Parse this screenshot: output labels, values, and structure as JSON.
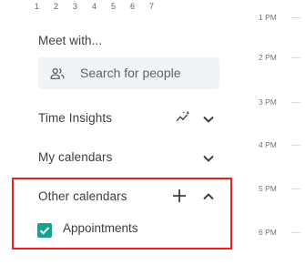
{
  "mini_calendar": {
    "day_numbers": [
      "1",
      "2",
      "3",
      "4",
      "5",
      "6",
      "7"
    ]
  },
  "meet": {
    "title": "Meet with...",
    "search_placeholder": "Search for people"
  },
  "time_insights": {
    "title": "Time Insights"
  },
  "my_calendars": {
    "title": "My calendars"
  },
  "other_calendars": {
    "title": "Other calendars",
    "items": [
      {
        "label": "Appointments",
        "checked": true,
        "color": "#14a391"
      }
    ]
  },
  "highlight_color": "#e8221a",
  "time_axis": [
    "1 PM",
    "2 PM",
    "3 PM",
    "4 PM",
    "5 PM",
    "6 PM"
  ],
  "icons": {
    "search_people": "people-icon",
    "time_insights": "insights-sparkle-icon",
    "expand": "chevron-down-icon",
    "collapse": "chevron-up-icon",
    "add": "plus-icon",
    "check": "check-icon"
  }
}
